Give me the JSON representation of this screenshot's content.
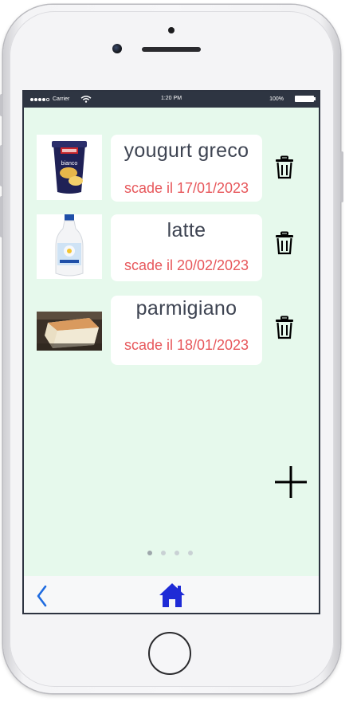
{
  "status_bar": {
    "carrier": "Carrier",
    "time": "1:20 PM",
    "battery": "100%",
    "signal_icon": "signal-dots-icon",
    "wifi_icon": "wifi-icon",
    "battery_icon": "battery-icon"
  },
  "items": [
    {
      "name": "yougurt greco",
      "expiry": "scade il 17/01/2023",
      "image_icon": "yogurt-pot-icon"
    },
    {
      "name": "latte",
      "expiry": "scade il 20/02/2023",
      "image_icon": "milk-bottle-icon"
    },
    {
      "name": "parmigiano",
      "expiry": "scade il 18/01/2023",
      "image_icon": "cheese-wedge-icon"
    }
  ],
  "actions": {
    "delete_icon": "trash-icon",
    "add_icon": "plus-icon"
  },
  "pager": {
    "pages": 4,
    "current": 1
  },
  "tab_bar": {
    "back_icon": "chevron-left-icon",
    "home_icon": "home-icon"
  },
  "colors": {
    "background": "#e6f9ec",
    "expiry_text": "#e7575b",
    "name_text": "#3e4452",
    "accent": "#1e2bd6",
    "status_bar": "#2e3542"
  }
}
